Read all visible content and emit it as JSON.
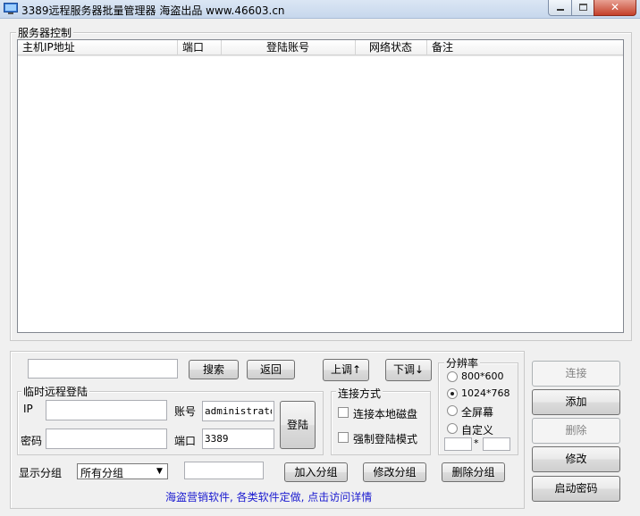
{
  "window": {
    "title": "3389远程服务器批量管理器 海盗出品  www.46603.cn"
  },
  "server_control": {
    "label": "服务器控制",
    "columns": [
      "主机IP地址",
      "端口",
      "登陆账号",
      "网络状态",
      "备注"
    ],
    "rows": []
  },
  "search": {
    "value": "",
    "search_label": "搜索",
    "back_label": "返回"
  },
  "move": {
    "up_label": "上调↑",
    "down_label": "下调↓"
  },
  "temp_login": {
    "label": "临时远程登陆",
    "ip_label": "IP",
    "ip_value": "",
    "account_label": "账号",
    "account_value": "administrator",
    "password_label": "密码",
    "password_value": "",
    "port_label": "端口",
    "port_value": "3389",
    "login_label": "登陆"
  },
  "connect_mode": {
    "label": "连接方式",
    "local_disk_label": "连接本地磁盘",
    "local_disk_checked": false,
    "force_login_label": "强制登陆模式",
    "force_login_checked": false
  },
  "resolution": {
    "label": "分辨率",
    "options": [
      "800*600",
      "1024*768",
      "全屏幕",
      "自定义"
    ],
    "selected": "1024*768",
    "custom_width": "",
    "custom_height": "",
    "separator": "*"
  },
  "side_buttons": {
    "connect_label": "连接",
    "add_label": "添加",
    "delete_label": "删除",
    "modify_label": "修改",
    "boot_password_label": "启动密码"
  },
  "group": {
    "display_label": "显示分组",
    "selected": "所有分组",
    "name_value": "",
    "add_label": "加入分组",
    "modify_label": "修改分组",
    "delete_label": "删除分组"
  },
  "footer": {
    "link_text": "海盗营销软件, 各类软件定做, 点击访问详情"
  }
}
